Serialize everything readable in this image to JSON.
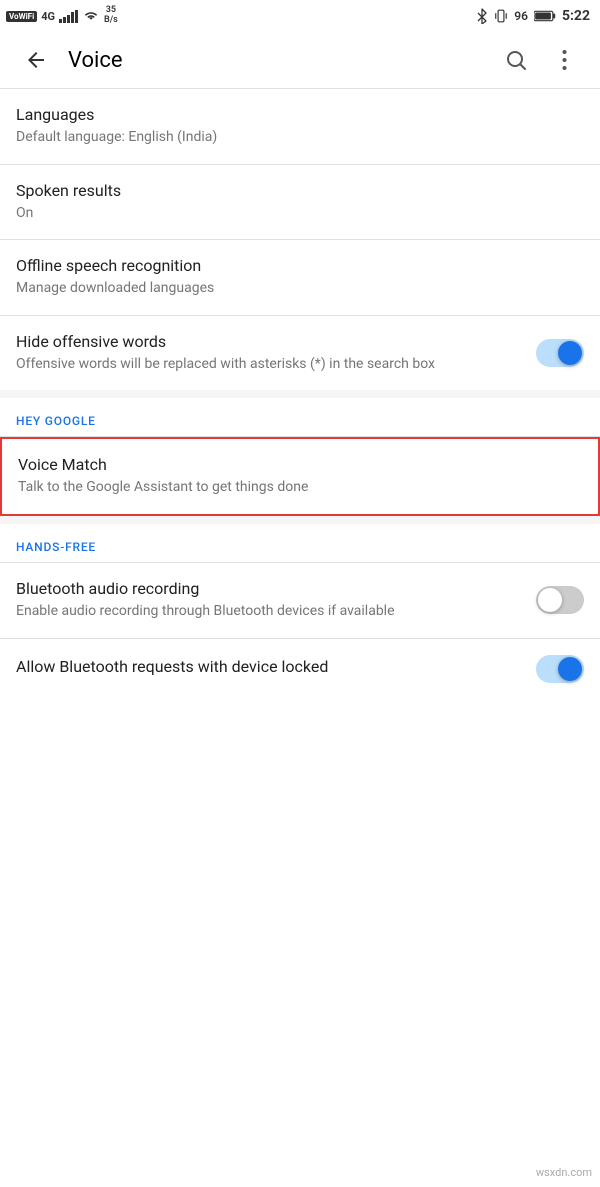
{
  "statusBar": {
    "wifi": "VoWiFi",
    "network": "4G",
    "networkSpeed": "35\nB/s",
    "time": "5:22",
    "battery": "96"
  },
  "header": {
    "title": "Voice",
    "backLabel": "back",
    "searchLabel": "search",
    "moreLabel": "more options"
  },
  "settings": [
    {
      "id": "languages",
      "title": "Languages",
      "subtitle": "Default language: English (India)",
      "type": "simple"
    },
    {
      "id": "spoken-results",
      "title": "Spoken results",
      "subtitle": "On",
      "type": "simple"
    },
    {
      "id": "offline-speech",
      "title": "Offline speech recognition",
      "subtitle": "Manage downloaded languages",
      "type": "simple"
    },
    {
      "id": "hide-offensive",
      "title": "Hide offensive words",
      "subtitle": "Offensive words will be replaced with asterisks (*) in the search box",
      "type": "toggle",
      "toggleState": "on"
    }
  ],
  "sections": [
    {
      "id": "hey-google",
      "label": "HEY GOOGLE",
      "items": [
        {
          "id": "voice-match",
          "title": "Voice Match",
          "subtitle": "Talk to the Google Assistant to get things done",
          "highlighted": true
        }
      ]
    },
    {
      "id": "hands-free",
      "label": "HANDS-FREE",
      "items": [
        {
          "id": "bluetooth-audio",
          "title": "Bluetooth audio recording",
          "subtitle": "Enable audio recording through Bluetooth devices if available",
          "type": "toggle",
          "toggleState": "off"
        },
        {
          "id": "bluetooth-locked",
          "title": "Allow Bluetooth requests with device locked",
          "subtitle": "",
          "type": "toggle",
          "toggleState": "on"
        }
      ]
    }
  ],
  "watermark": "wsxdn.com"
}
